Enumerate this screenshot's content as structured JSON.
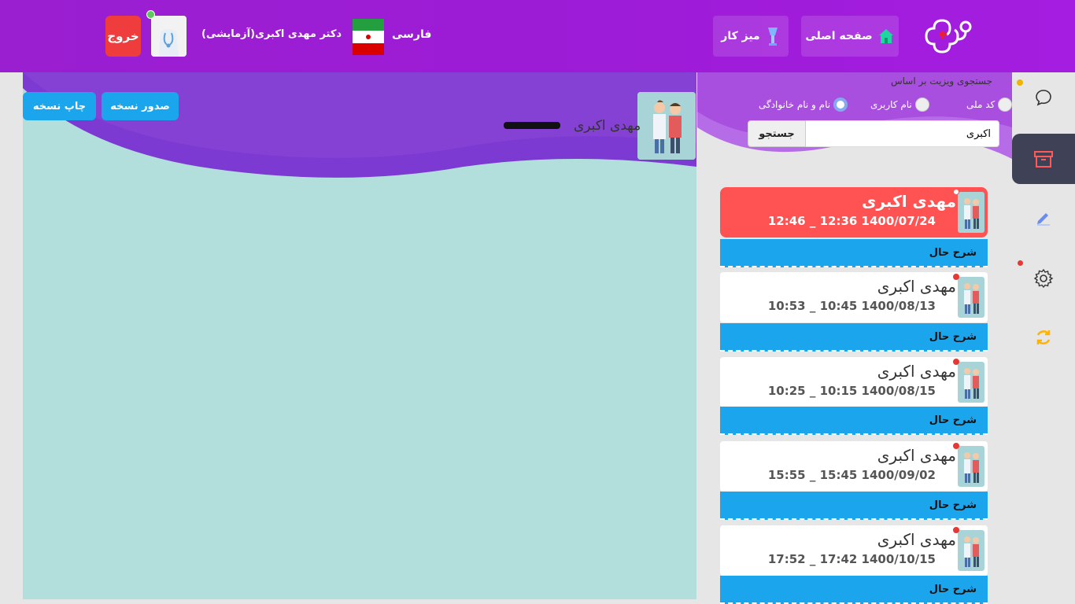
{
  "header": {
    "home_label": "صفحه اصلی",
    "desk_label": "میز کار",
    "language": "فارسی",
    "doctor_name": "دکتر مهدی اکبری(آزمایشی)",
    "logout_label": "خروج"
  },
  "search": {
    "title": "جستجوی ویزیت بر اساس",
    "options": [
      "کد ملی",
      "نام کاربری",
      "نام و نام خانوادگی"
    ],
    "selected_option": "نام کاربری",
    "input_value": "اکبری",
    "button_label": "جستجو"
  },
  "patient": {
    "name": "مهدی اکبری"
  },
  "actions": {
    "issue_label": "صدور نسخه",
    "print_label": "چاپ نسخه"
  },
  "visits": [
    {
      "name": "مهدی اکبری",
      "time": "12:46 _ 12:36 1400/07/24",
      "desc_label": "شرح حال"
    },
    {
      "name": "مهدی اکبری",
      "time": "10:53 _ 10:45 1400/08/13",
      "desc_label": "شرح حال"
    },
    {
      "name": "مهدی اکبری",
      "time": "10:25 _ 10:15 1400/08/15",
      "desc_label": "شرح حال"
    },
    {
      "name": "مهدی اکبری",
      "time": "15:55 _ 15:45 1400/09/02",
      "desc_label": "شرح حال"
    },
    {
      "name": "مهدی اکبری",
      "time": "17:52 _ 17:42 1400/10/15",
      "desc_label": "شرح حال"
    }
  ],
  "sidebar": {
    "icons": [
      "chat-icon",
      "archive-icon",
      "pencil-icon",
      "gear-icon",
      "refresh-icon"
    ]
  },
  "colors": {
    "header": "#9c1cd6",
    "accent_blue": "#1aa5ec",
    "active_card": "#ff5252",
    "panel": "#b2dfdb",
    "logout": "#ef3c3c"
  }
}
